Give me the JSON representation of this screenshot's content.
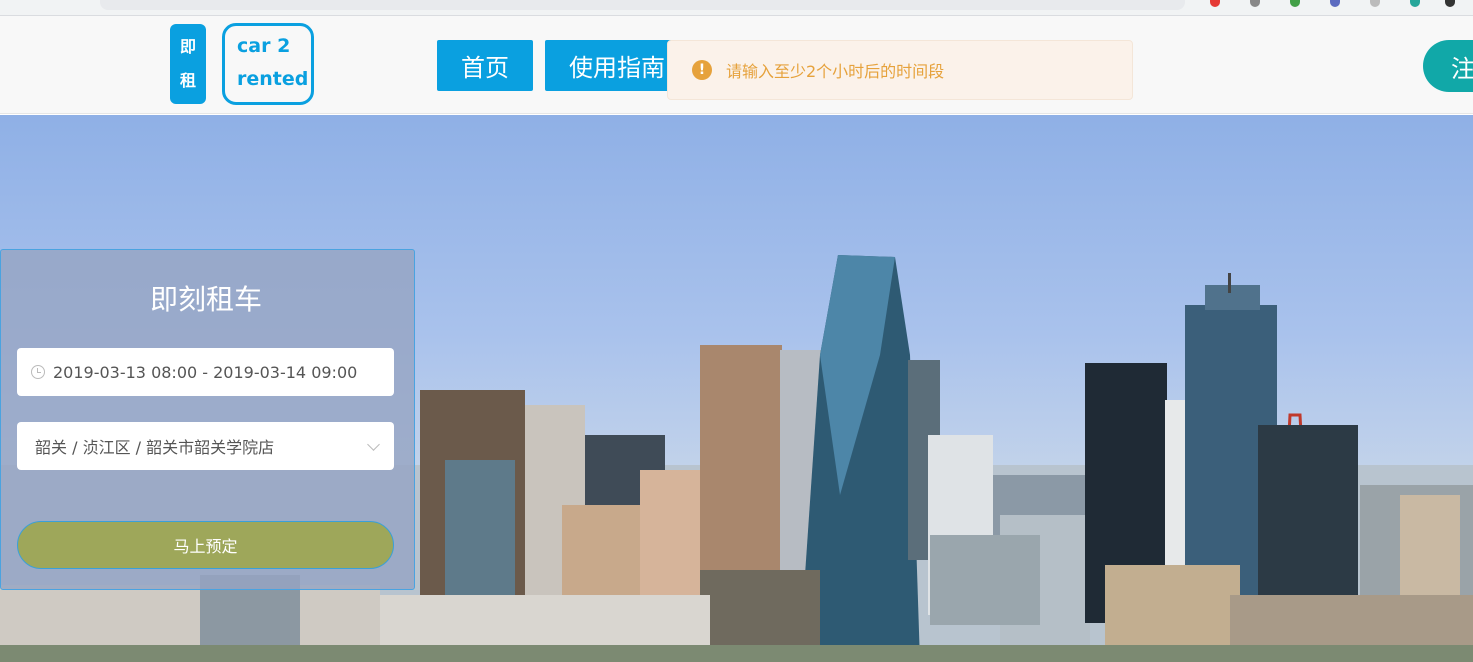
{
  "header": {
    "logo_mark_line1": "即",
    "logo_mark_line2": "租",
    "logo_text_line1": "car 2",
    "logo_text_line2": "rented",
    "nav": {
      "home": "首页",
      "guide": "使用指南"
    },
    "register_label": "注"
  },
  "toast": {
    "icon": "!",
    "message": "请输入至少2个小时后的时间段"
  },
  "booking": {
    "title": "即刻租车",
    "date_range": "2019-03-13 08:00  - 2019-03-14 09:00",
    "store": "韶关 / 浈江区 / 韶关市韶关学院店",
    "submit_label": "马上预定"
  },
  "colors": {
    "brand": "#0aa0e0",
    "warning": "#e6a23c",
    "register": "#11a8a8"
  }
}
